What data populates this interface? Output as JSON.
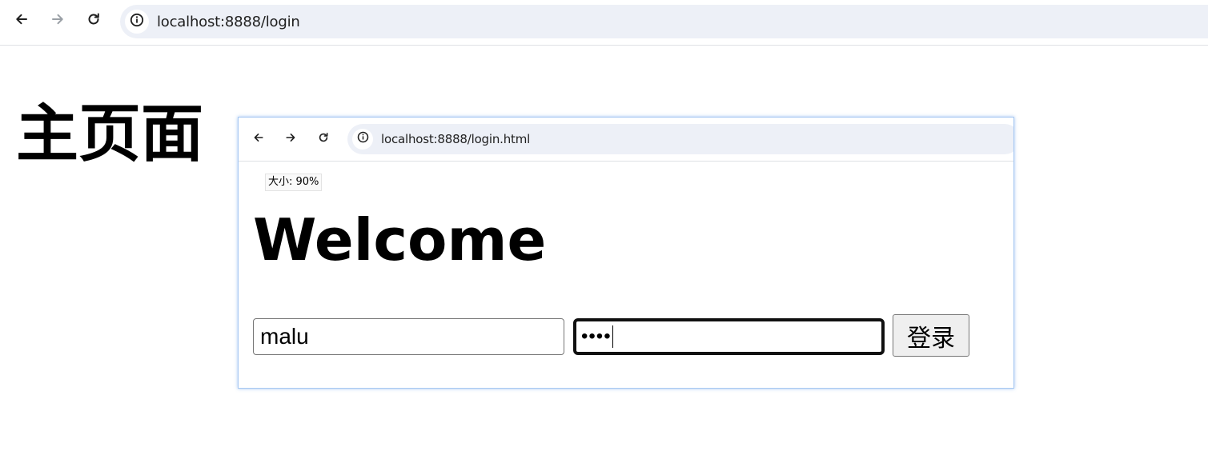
{
  "browser": {
    "url": "localhost:8888/login",
    "icons": {
      "back": "arrow-left-icon",
      "forward": "arrow-right-icon",
      "reload": "reload-icon",
      "site_info": "info-circle-icon"
    }
  },
  "page": {
    "heading": "主页面"
  },
  "embedded": {
    "url": "localhost:8888/login.html",
    "zoom_label": "大小: 90%",
    "welcome": "Welcome",
    "username_value": "malu",
    "password_mask": "••••",
    "login_label": "登录"
  }
}
